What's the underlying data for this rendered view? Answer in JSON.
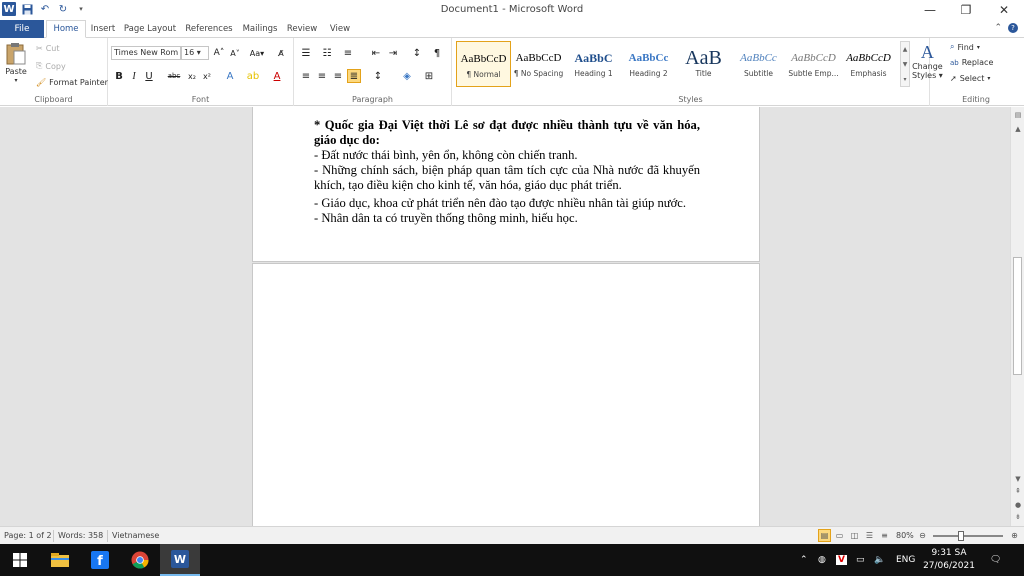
{
  "window": {
    "title": "Document1 - Microsoft Word"
  },
  "colors": {
    "accent": "#2b579a",
    "highlight": "#fcd87e",
    "taskbar": "#101010"
  },
  "tabs": [
    {
      "label": "File"
    },
    {
      "label": "Home"
    },
    {
      "label": "Insert"
    },
    {
      "label": "Page Layout"
    },
    {
      "label": "References"
    },
    {
      "label": "Mailings"
    },
    {
      "label": "Review"
    },
    {
      "label": "View"
    }
  ],
  "ribbon": {
    "clipboard": {
      "label": "Clipboard",
      "paste": "Paste",
      "cut": "Cut",
      "copy": "Copy",
      "format_painter": "Format Painter"
    },
    "font": {
      "label": "Font",
      "family": "Times New Rom",
      "size": "16"
    },
    "paragraph": {
      "label": "Paragraph"
    },
    "styles": {
      "label": "Styles",
      "items": [
        {
          "sample": "AaBbCcD",
          "name": "¶ Normal"
        },
        {
          "sample": "AaBbCcD",
          "name": "¶ No Spacing"
        },
        {
          "sample": "AaBbC",
          "name": "Heading 1"
        },
        {
          "sample": "AaBbCc",
          "name": "Heading 2"
        },
        {
          "sample": "AaB",
          "name": "Title"
        },
        {
          "sample": "AaBbCc",
          "name": "Subtitle"
        },
        {
          "sample": "AaBbCcD",
          "name": "Subtle Emp..."
        },
        {
          "sample": "AaBbCcD",
          "name": "Emphasis"
        }
      ],
      "change_styles_1": "Change",
      "change_styles_2": "Styles"
    },
    "editing": {
      "label": "Editing",
      "find": "Find",
      "replace": "Replace",
      "select": "Select"
    }
  },
  "document": {
    "heading": "* Quốc gia Đại Việt thời Lê sơ đạt được nhiều thành tựu về văn hóa, giáo dục do:",
    "lines": [
      "- Đất nước thái bình, yên ổn, không còn chiến tranh.",
      "- Những chính sách, biện pháp quan tâm tích cực của Nhà nước đã khuyến khích, tạo điều kiện cho kinh tế, văn hóa, giáo dục phát triển.",
      "- Giáo dục, khoa cử phát triển nên đào tạo được nhiều nhân tài giúp nước.",
      "- Nhân dân ta có truyền thống thông minh, hiếu học."
    ]
  },
  "status": {
    "page": "Page: 1 of 2",
    "words": "Words: 358",
    "language": "Vietnamese",
    "zoom": "80%",
    "zoom_level": 0.4
  },
  "taskbar": {
    "lang": "ENG",
    "time": "9:31 SA",
    "date": "27/06/2021"
  }
}
